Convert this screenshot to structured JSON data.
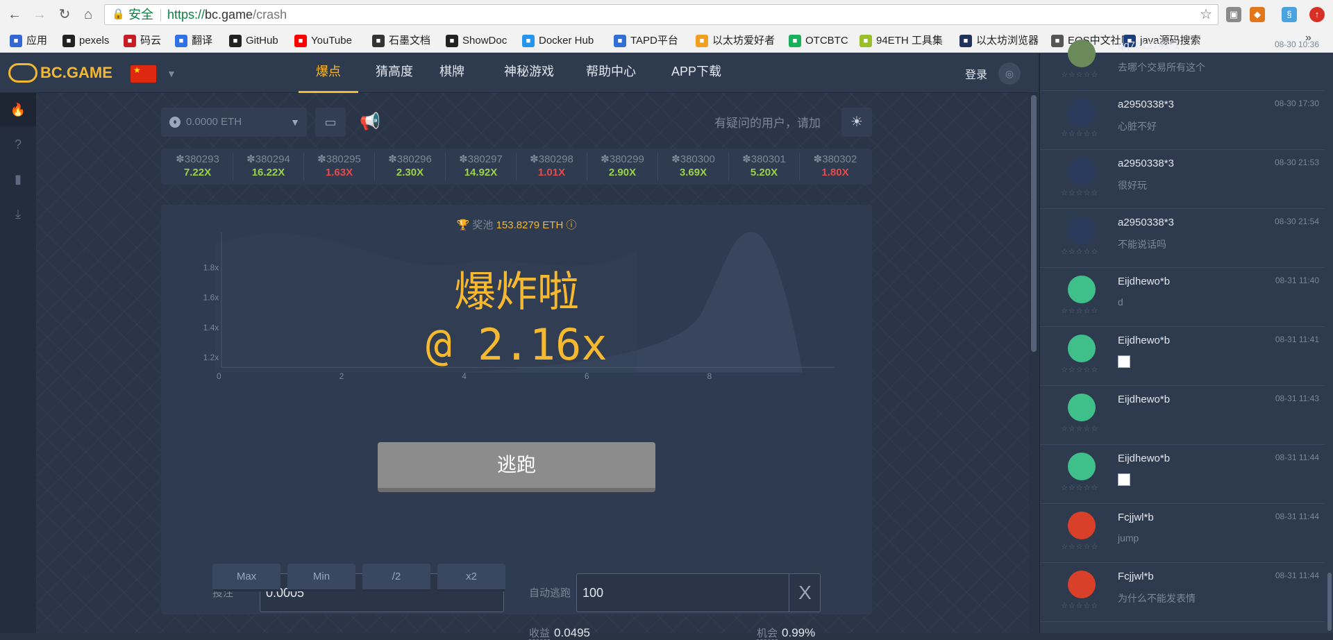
{
  "browser": {
    "secure_label": "安全",
    "url_scheme": "https://",
    "url_host": "bc.game",
    "url_path": "/crash",
    "bookmarks": [
      {
        "label": "应用",
        "icon": "apps-icon",
        "color": "#3367d6"
      },
      {
        "label": "pexels",
        "icon": "camera-icon",
        "color": "#222222"
      },
      {
        "label": "码云",
        "icon": "gitee-icon",
        "color": "#c71d23"
      },
      {
        "label": "翻译",
        "icon": "translate-icon",
        "color": "#2f72e6"
      },
      {
        "label": "GitHub",
        "icon": "github-icon",
        "color": "#222222"
      },
      {
        "label": "YouTube",
        "icon": "youtube-icon",
        "color": "#ff0000"
      },
      {
        "label": "石墨文档",
        "icon": "shimo-icon",
        "color": "#333333"
      },
      {
        "label": "ShowDoc",
        "icon": "showdoc-icon",
        "color": "#222222"
      },
      {
        "label": "Docker Hub",
        "icon": "docker-icon",
        "color": "#2496ed"
      },
      {
        "label": "TAPD平台",
        "icon": "tapd-icon",
        "color": "#2f6fd6"
      },
      {
        "label": "以太坊爱好者",
        "icon": "ethereum-icon",
        "color": "#f0a020"
      },
      {
        "label": "OTCBTC",
        "icon": "otcbtc-icon",
        "color": "#1aaf5d"
      },
      {
        "label": "94ETH 工具集",
        "icon": "tool-icon",
        "color": "#9bbf2a"
      },
      {
        "label": "以太坊浏览器",
        "icon": "etherscan-icon",
        "color": "#21325b"
      },
      {
        "label": "EOS中文社区",
        "icon": "eos-icon",
        "color": "#555555"
      },
      {
        "label": "java源码搜索",
        "icon": "gc-icon",
        "color": "#1a3f7a"
      }
    ]
  },
  "nav": {
    "logo": "BC.GAME",
    "items": [
      {
        "label": "爆点",
        "active": true
      },
      {
        "label": "猜高度",
        "active": false
      },
      {
        "label": "棋牌",
        "active": false
      },
      {
        "label": "神秘游戏",
        "active": false
      },
      {
        "label": "帮助中心",
        "active": false
      },
      {
        "label": "APP下载",
        "active": false
      }
    ],
    "login": "登录"
  },
  "toolbar": {
    "balance": "0.0000 ETH",
    "notice": "有疑问的用户，请加"
  },
  "history": [
    {
      "id": "380293",
      "value": "7.22X",
      "color": "#9bd24a"
    },
    {
      "id": "380294",
      "value": "16.22X",
      "color": "#9bd24a"
    },
    {
      "id": "380295",
      "value": "1.63X",
      "color": "#e54b4b"
    },
    {
      "id": "380296",
      "value": "2.30X",
      "color": "#9bd24a"
    },
    {
      "id": "380297",
      "value": "14.92X",
      "color": "#9bd24a"
    },
    {
      "id": "380298",
      "value": "1.01X",
      "color": "#e54b4b"
    },
    {
      "id": "380299",
      "value": "2.90X",
      "color": "#9bd24a"
    },
    {
      "id": "380300",
      "value": "3.69X",
      "color": "#9bd24a"
    },
    {
      "id": "380301",
      "value": "5.20X",
      "color": "#9bd24a"
    },
    {
      "id": "380302",
      "value": "1.80X",
      "color": "#e54b4b"
    }
  ],
  "game": {
    "pool_label": "奖池",
    "pool_amount": "153.8279 ETH",
    "bust_title": "爆炸啦",
    "bust_value": "@ 2.16x",
    "escape_button": "逃跑",
    "bet_label": "投注",
    "bet_value": "0.0005",
    "auto_label": "自动逃跑",
    "auto_value": "100",
    "auto_clear": "X",
    "quick_buttons": [
      "Max",
      "Min",
      "/2",
      "x2"
    ],
    "profit_label": "收益",
    "profit_value": "0.0495",
    "chance_label": "机会",
    "chance_value": "0.99%"
  },
  "chart_data": {
    "type": "area",
    "y_ticks": [
      "1.8x",
      "1.6x",
      "1.4x",
      "1.2x"
    ],
    "x_ticks": [
      "0",
      "2",
      "4",
      "6",
      "8"
    ]
  },
  "chat": [
    {
      "name": "qq7612741*1",
      "time": "08-30 10:36",
      "text": "去哪个交易所有这个",
      "avatar": "#6a8a5a",
      "image": false
    },
    {
      "name": "a2950338*3",
      "time": "08-30 17:30",
      "text": "心脏不好",
      "avatar": "#2a3a5a",
      "image": false
    },
    {
      "name": "a2950338*3",
      "time": "08-30 21:53",
      "text": "很好玩",
      "avatar": "#2a3a5a",
      "image": false
    },
    {
      "name": "a2950338*3",
      "time": "08-30 21:54",
      "text": "不能说话吗",
      "avatar": "#2a3a5a",
      "image": false
    },
    {
      "name": "Eijdhewo*b",
      "time": "08-31 11:40",
      "text": "d",
      "avatar": "#3fbf8a",
      "image": false
    },
    {
      "name": "Eijdhewo*b",
      "time": "08-31 11:41",
      "text": "",
      "avatar": "#3fbf8a",
      "image": true
    },
    {
      "name": "Eijdhewo*b",
      "time": "08-31 11:43",
      "text": "",
      "avatar": "#3fbf8a",
      "image": false
    },
    {
      "name": "Eijdhewo*b",
      "time": "08-31 11:44",
      "text": "",
      "avatar": "#3fbf8a",
      "image": true
    },
    {
      "name": "Fcjjwl*b",
      "time": "08-31 11:44",
      "text": "jump",
      "avatar": "#d8402a",
      "image": false
    },
    {
      "name": "Fcjjwl*b",
      "time": "08-31 11:44",
      "text": "为什么不能发表情",
      "avatar": "#d8402a",
      "image": false
    }
  ]
}
